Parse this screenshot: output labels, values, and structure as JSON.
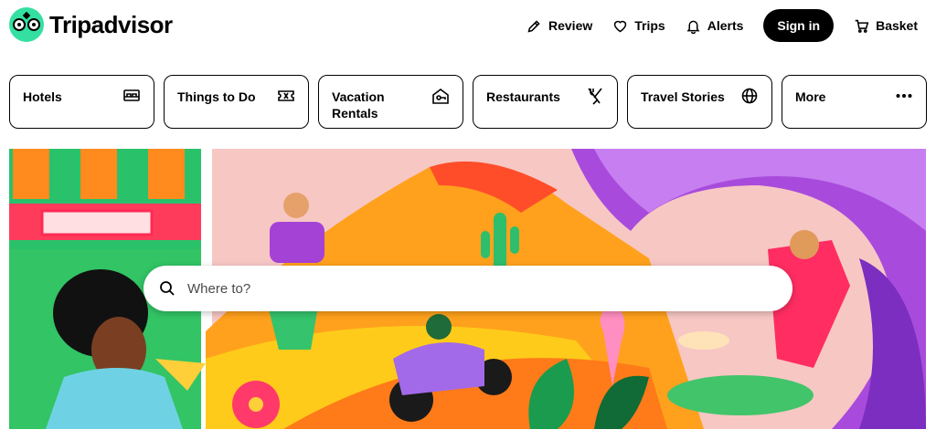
{
  "brand": {
    "name": "Tripadvisor",
    "color": "#34e0a1"
  },
  "nav": {
    "review": "Review",
    "trips": "Trips",
    "alerts": "Alerts",
    "sign_in": "Sign in",
    "basket": "Basket"
  },
  "categories": [
    {
      "label": "Hotels",
      "icon": "bed-icon"
    },
    {
      "label": "Things to Do",
      "icon": "ticket-icon"
    },
    {
      "label": "Vacation Rentals",
      "icon": "house-key-icon"
    },
    {
      "label": "Restaurants",
      "icon": "fork-knife-icon"
    },
    {
      "label": "Travel Stories",
      "icon": "globe-icon"
    },
    {
      "label": "More",
      "icon": "more-dots-icon"
    }
  ],
  "search": {
    "placeholder": "Where to?",
    "value": ""
  },
  "hero": {
    "illustration": "travel-collage-illustration"
  }
}
